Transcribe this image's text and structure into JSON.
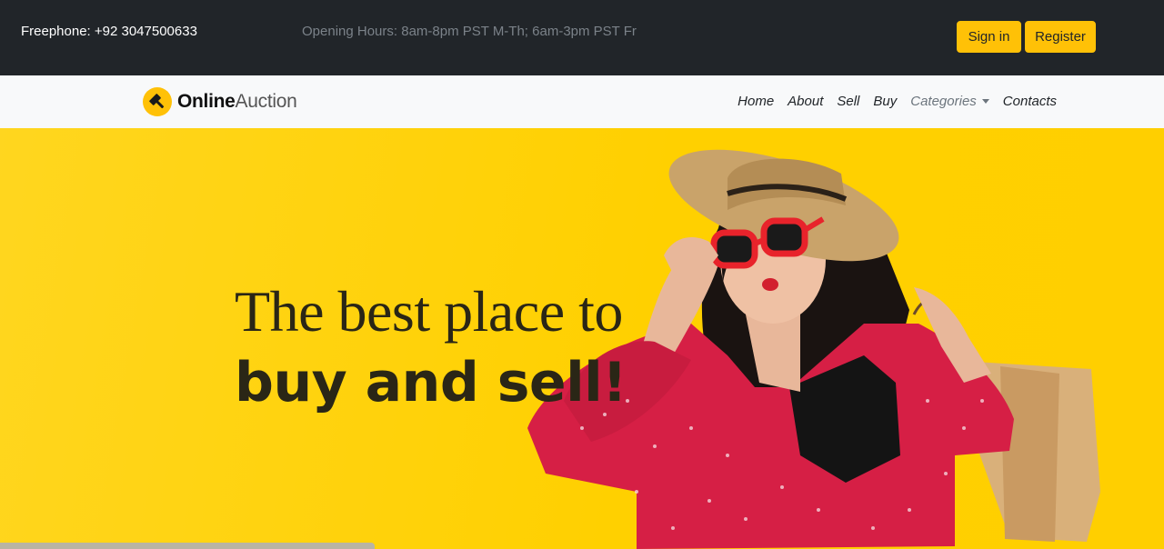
{
  "topbar": {
    "freephone": "Freephone: +92 3047500633",
    "hours": "Opening Hours: 8am-8pm PST M-Th; 6am-3pm PST Fr",
    "signin_label": "Sign in",
    "register_label": "Register"
  },
  "brand": {
    "name_bold": "Online",
    "name_light": "Auction",
    "icon": "gavel-icon"
  },
  "nav": {
    "items": [
      {
        "label": "Home"
      },
      {
        "label": "About"
      },
      {
        "label": "Sell"
      },
      {
        "label": "Buy"
      },
      {
        "label": "Categories"
      },
      {
        "label": "Contacts"
      }
    ]
  },
  "hero": {
    "line1": "The best place to",
    "line2": "buy and sell!"
  },
  "colors": {
    "accent": "#ffc107",
    "topbar": "#212529",
    "hero_bg": "#ffd000",
    "dress": "#d61f45",
    "glasses": "#e8232b"
  }
}
